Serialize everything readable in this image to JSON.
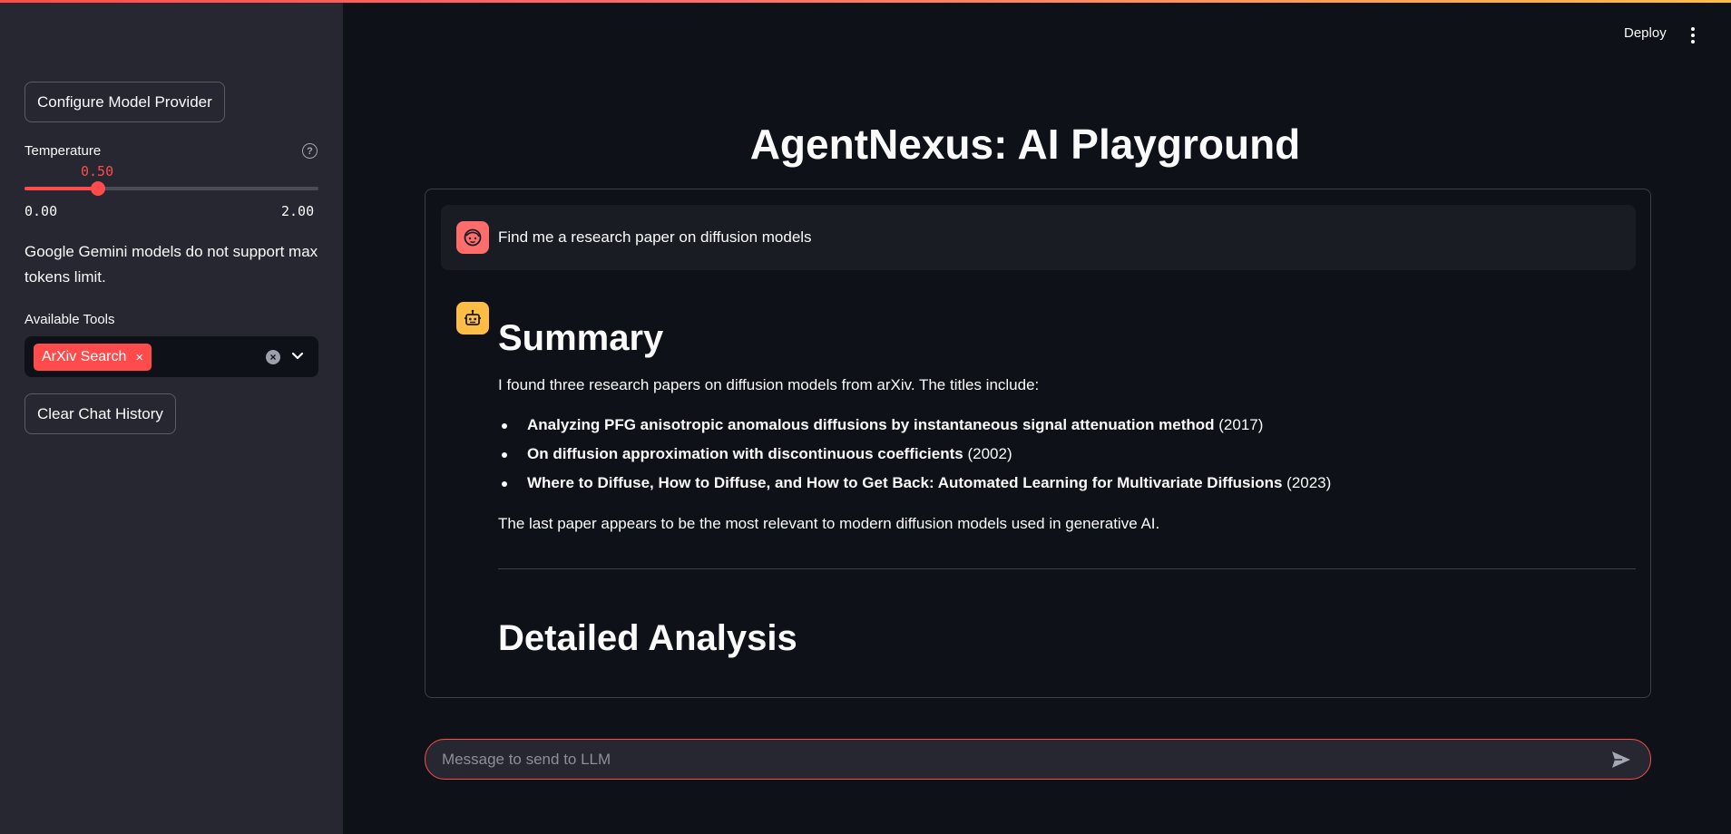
{
  "sidebar": {
    "configure_button": "Configure Model Provider",
    "temperature": {
      "label": "Temperature",
      "value": 0.5,
      "value_text": "0.50",
      "min_text": "0.00",
      "max_text": "2.00",
      "min": 0,
      "max": 2
    },
    "note": "Google Gemini models do not support max tokens limit.",
    "tools": {
      "label": "Available Tools",
      "selected": [
        "ArXiv Search"
      ],
      "chip_remove": "×"
    },
    "clear_button": "Clear Chat History"
  },
  "header": {
    "deploy_label": "Deploy"
  },
  "main": {
    "title": "AgentNexus: AI Playground",
    "messages": {
      "user_text": "Find me a research paper on diffusion models",
      "bot": {
        "heading": "Summary",
        "intro": "I found three research papers on diffusion models from arXiv. The titles include:",
        "papers": [
          {
            "title": "Analyzing PFG anisotropic anomalous diffusions by instantaneous signal attenuation method",
            "year": "(2017)"
          },
          {
            "title": "On diffusion approximation with discontinuous coefficients",
            "year": "(2002)"
          },
          {
            "title": "Where to Diffuse, How to Diffuse, and How to Get Back: Automated Learning for Multivariate Diffusions",
            "year": "(2023)"
          }
        ],
        "conclusion": "The last paper appears to be the most relevant to modern diffusion models used in generative AI.",
        "heading2": "Detailed Analysis"
      }
    },
    "chat_input": {
      "placeholder": "Message to send to LLM"
    }
  },
  "colors": {
    "accent": "#ff4b4b",
    "sidebar_bg": "#262730",
    "main_bg": "#0e1117",
    "bot_avatar": "#ffbd45",
    "user_avatar": "#ff6c6c"
  },
  "icons": {
    "help": "question-circle-icon",
    "clear": "clear-x-icon",
    "chevron": "chevron-down-icon",
    "menu": "kebab-menu-icon",
    "user_avatar": "user-face-icon",
    "bot_avatar": "robot-icon",
    "send": "send-icon"
  }
}
